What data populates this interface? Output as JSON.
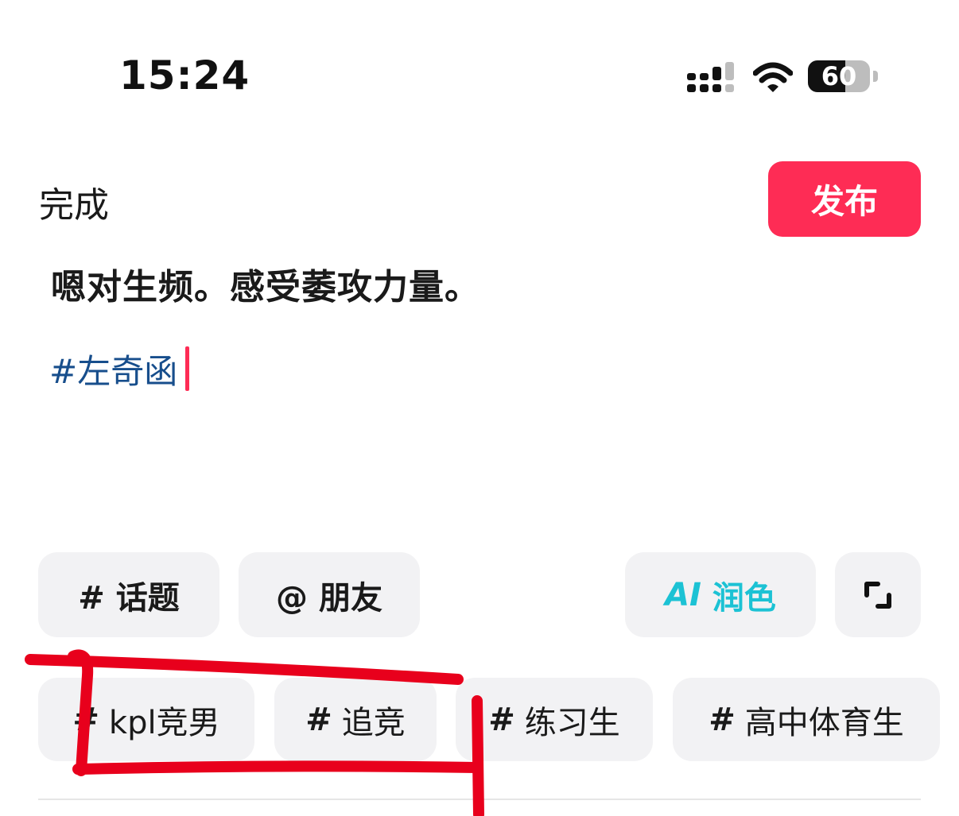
{
  "status_bar": {
    "time": "15:24",
    "battery_level": "60",
    "battery_fraction": 0.6,
    "signal_icon": "cellular-signal-icon",
    "wifi_icon": "wifi-icon"
  },
  "header": {
    "done_label": "完成",
    "publish_label": "发布",
    "publish_color": "#fe2c55"
  },
  "editor": {
    "text": "嗯对生频。感受萎攻力量。",
    "hashtag": "#左奇函",
    "hashtag_color": "#174e8c",
    "caret_color": "#fe2c55"
  },
  "toolbar": {
    "topic_button": "# 话题",
    "friend_button": "@ 朋友",
    "ai_prefix": "AI",
    "ai_label": "润色",
    "ai_color": "#1cc2d4",
    "expand_icon": "expand-icon"
  },
  "suggestions": [
    {
      "hash": "#",
      "label": "kpl竞男"
    },
    {
      "hash": "#",
      "label": "追竞"
    },
    {
      "hash": "#",
      "label": "练习生"
    },
    {
      "hash": "#",
      "label": "高中体育生"
    }
  ],
  "annotation_color": "#e8001c"
}
